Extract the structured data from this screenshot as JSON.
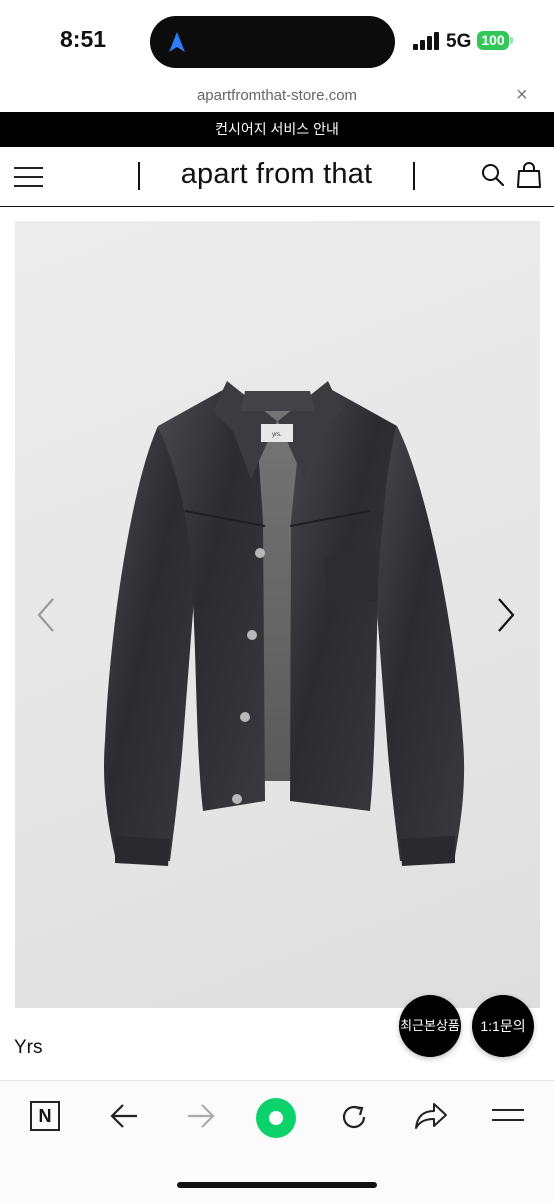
{
  "status_bar": {
    "time": "8:51",
    "network": "5G",
    "battery": "100"
  },
  "browser": {
    "url": "apartfromthat-store.com",
    "close_symbol": "×"
  },
  "banner": {
    "text": "컨시어지 서비스 안내"
  },
  "header": {
    "logo": "apart from that"
  },
  "product": {
    "name": "Yrs",
    "label_text": "yrs."
  },
  "floating": {
    "recent": "최근본상품",
    "inquiry": "1:1문의"
  },
  "toolbar": {
    "tabs_icon": "N"
  },
  "colors": {
    "banner_bg": "#000000",
    "battery": "#32c759",
    "accent": "#0bd26a"
  },
  "icons": [
    "location-arrow-icon",
    "signal-icon",
    "menu-icon",
    "search-icon",
    "shopping-bag-icon",
    "chevron-left-icon",
    "chevron-right-icon",
    "back-icon",
    "forward-icon",
    "record-icon",
    "reload-icon",
    "share-icon"
  ]
}
